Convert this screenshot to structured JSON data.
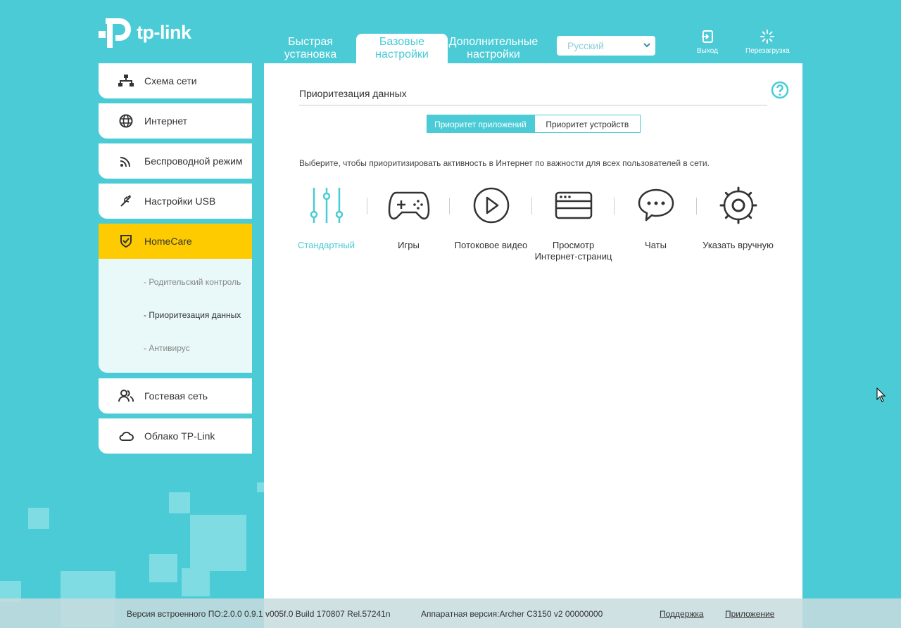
{
  "brand": {
    "logo_text": "tp-link"
  },
  "header": {
    "tabs": [
      {
        "label": "Быстрая установка",
        "line1": "Быстрая",
        "line2": "установка"
      },
      {
        "label": "Базовые настройки",
        "line1": "Базовые",
        "line2": "настройки"
      },
      {
        "label": "Дополнительные настройки",
        "line1": "Дополнительные",
        "line2": "настройки"
      }
    ],
    "language": "Русский",
    "logout_label": "Выход",
    "reboot_label": "Перезагрузка"
  },
  "sidebar": {
    "items": [
      {
        "label": "Схема сети",
        "icon": "network-map-icon"
      },
      {
        "label": "Интернет",
        "icon": "globe-icon"
      },
      {
        "label": "Беспроводной режим",
        "icon": "wireless-icon"
      },
      {
        "label": "Настройки USB",
        "icon": "usb-icon"
      },
      {
        "label": "HomeCare",
        "icon": "shield-icon"
      },
      {
        "label": "Гостевая сеть",
        "icon": "guests-icon"
      },
      {
        "label": "Облако TP-Link",
        "icon": "cloud-icon"
      }
    ],
    "subitems": [
      "- Родительский контроль",
      "- Приоритезация данных",
      "- Антивирус"
    ]
  },
  "main": {
    "title": "Приоритезация данных",
    "segments": [
      "Приоритет приложений",
      "Приоритет устройств"
    ],
    "description": "Выберите, чтобы приоритизировать активность в Интернет по важности для всех пользователей в сети.",
    "modes": [
      {
        "label": "Стандартный",
        "icon": "sliders-icon"
      },
      {
        "label": "Игры",
        "icon": "gamepad-icon"
      },
      {
        "label": "Потоковое видео",
        "icon": "play-icon"
      },
      {
        "label": "Просмотр Интернет-страниц",
        "line1": "Просмотр",
        "line2": "Интернет-страниц",
        "icon": "browser-icon"
      },
      {
        "label": "Чаты",
        "icon": "chat-icon"
      },
      {
        "label": "Указать вручную",
        "icon": "gear-icon"
      }
    ]
  },
  "footer": {
    "firmware": "Версия встроенного ПО:2.0.0 0.9.1 v005f.0 Build 170807 Rel.57241n",
    "hardware": "Аппаратная версия:Archer C3150 v2 00000000",
    "support": "Поддержка",
    "app": "Приложение"
  },
  "colors": {
    "accent": "#4acbd6",
    "highlight": "#fecb00"
  }
}
